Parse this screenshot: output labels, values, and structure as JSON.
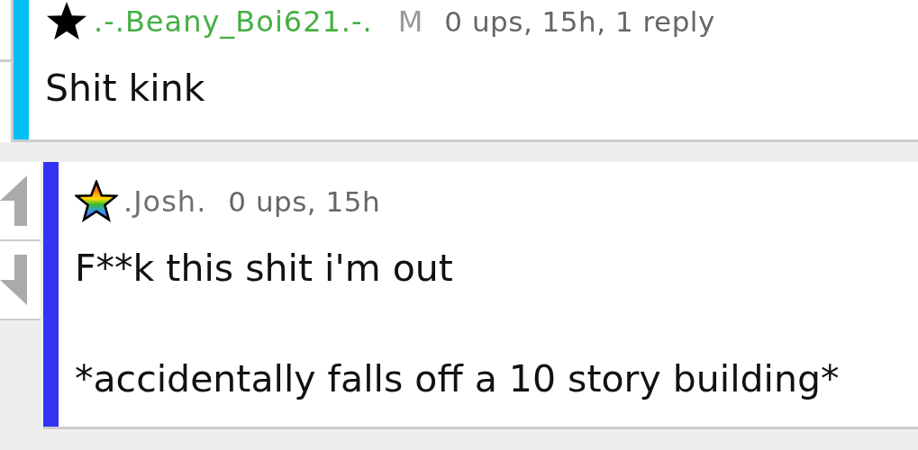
{
  "comments": [
    {
      "color": "#00bff3",
      "user": {
        "name": ".-.Beany_Boi621.-.",
        "color": "#44b044",
        "kind": "star"
      },
      "mod_badge": "M",
      "meta": "0 ups, 15h, 1 reply",
      "body": [
        "Shit kink"
      ],
      "votes_visible": false
    },
    {
      "color": "#3333f5",
      "user": {
        "name": ".Josh.",
        "color": "#707070",
        "kind": "rainbow-star"
      },
      "meta": "0 ups, 15h",
      "body": [
        "F**k this shit i'm out",
        "*accidentally falls off a 10 story building*"
      ],
      "votes_visible": true
    }
  ]
}
